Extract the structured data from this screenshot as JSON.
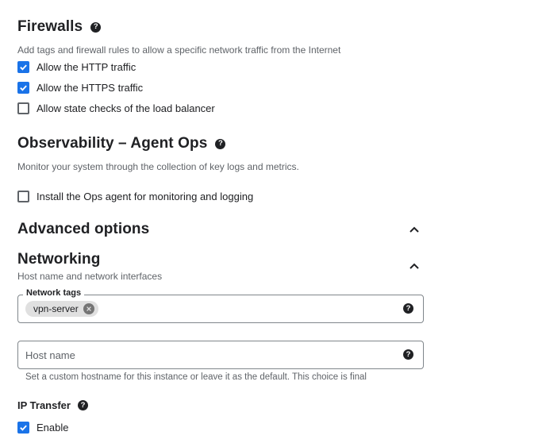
{
  "firewalls": {
    "title": "Firewalls",
    "description": "Add tags and firewall rules to allow a specific network traffic from the Internet",
    "checkboxes": [
      {
        "label": "Allow the HTTP traffic",
        "checked": true
      },
      {
        "label": "Allow the HTTPS traffic",
        "checked": true
      },
      {
        "label": "Allow state checks of the load balancer",
        "checked": false
      }
    ]
  },
  "observability": {
    "title": "Observability – Agent Ops",
    "description": "Monitor your system through the collection of key logs and metrics.",
    "checkbox": {
      "label": "Install the Ops agent for monitoring and logging",
      "checked": false
    }
  },
  "advanced": {
    "title": "Advanced options",
    "expand_icon": "chevron-up-icon"
  },
  "networking": {
    "title": "Networking",
    "subtitle": "Host name and network interfaces",
    "expand_icon": "chevron-up-icon",
    "network_tags": {
      "label": "Network tags",
      "chips": [
        "vpn-server"
      ]
    },
    "host_name": {
      "placeholder": "Host name",
      "value": "",
      "hint": "Set a custom hostname for this instance or leave it as the default. This choice is final"
    }
  },
  "ip_transfer": {
    "title": "IP Transfer",
    "checkbox": {
      "label": "Enable",
      "checked": true
    }
  },
  "help_glyph": "?",
  "colors": {
    "accent": "#1a73e8",
    "text": "#202124",
    "muted": "#5f6368",
    "border": "#80868b"
  }
}
